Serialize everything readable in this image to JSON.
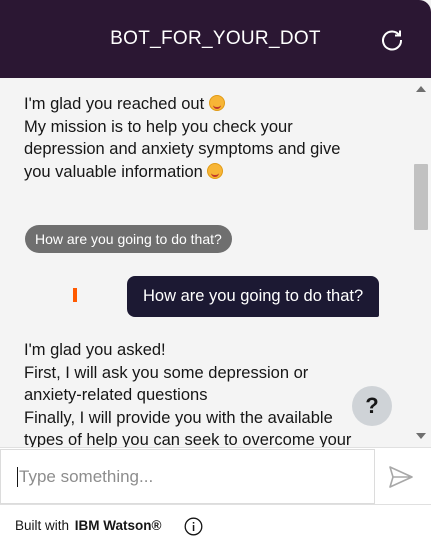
{
  "header": {
    "title": "BOT_FOR_YOUR_DOT",
    "restart_icon": "restart-icon"
  },
  "messages": {
    "bot_intro": {
      "line1": "I'm glad you reached out",
      "line2": "My mission is to help you check your",
      "line3": "depression and anxiety symptoms and give",
      "line4": "you valuable information"
    },
    "quick_reply": "How are you going to do that?",
    "user_message": "How are you going to do that?",
    "bot_reply": {
      "line1": "I'm glad you asked!",
      "line2": "First, I will ask you some depression or",
      "line3": "anxiety-related questions",
      "line4": "Finally, I will provide you with the available",
      "line5": "types of help you can seek to overcome your"
    },
    "help_button": "?"
  },
  "composer": {
    "placeholder": "Type something...",
    "value": "",
    "send_icon": "send-icon"
  },
  "footer": {
    "built_with": "Built with",
    "brand": "IBM Watson®",
    "info_icon": "info-icon"
  },
  "colors": {
    "header_bg": "#2b1733",
    "user_bubble_bg": "#1c1933",
    "quick_reply_bg": "#6f6f6f",
    "accent_orange": "#ff5a00"
  }
}
